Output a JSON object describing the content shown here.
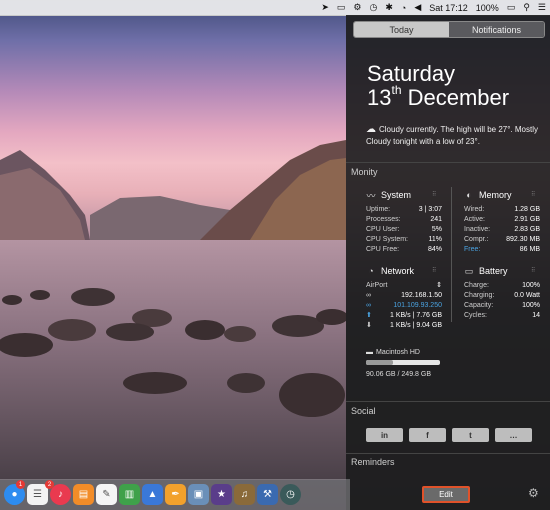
{
  "menubar": {
    "time": "Sat 17:12",
    "battery": "100%",
    "icons": [
      "location-icon",
      "airplay-icon",
      "gear-icon",
      "time-machine-icon",
      "bluetooth-icon",
      "wifi-icon",
      "volume-icon",
      "battery-icon",
      "search-icon",
      "menu-icon"
    ]
  },
  "notification_center": {
    "tabs": [
      "Today",
      "Notifications"
    ],
    "active_tab": "Notifications",
    "day": "Saturday",
    "date_num": "13",
    "date_suffix": "th",
    "month": "December",
    "weather": "Cloudy currently. The high will be 27°. Mostly Cloudy tonight with a low of 23°.",
    "monity_title": "Monity",
    "system": {
      "title": "System",
      "rows": [
        {
          "label": "Uptime:",
          "value": "3 | 3:07"
        },
        {
          "label": "Processes:",
          "value": "241"
        },
        {
          "label": "CPU User:",
          "value": "5%"
        },
        {
          "label": "CPU System:",
          "value": "11%"
        },
        {
          "label": "CPU Free:",
          "value": "84%"
        }
      ]
    },
    "memory": {
      "title": "Memory",
      "rows": [
        {
          "label": "Wired:",
          "value": "1.28 GB"
        },
        {
          "label": "Active:",
          "value": "2.91 GB"
        },
        {
          "label": "Inactive:",
          "value": "2.83 GB"
        },
        {
          "label": "Compr.:",
          "value": "892.30 MB"
        },
        {
          "label": "Free:",
          "value": "86 MB"
        }
      ]
    },
    "network": {
      "title": "Network",
      "interface": "AirPort",
      "local_ip": "192.168.1.50",
      "public_ip": "101.109.93.250",
      "upload": "1 KB/s | 7.76 GB",
      "download": "1 KB/s | 9.04 GB"
    },
    "battery": {
      "title": "Battery",
      "rows": [
        {
          "label": "Charge:",
          "value": "100%"
        },
        {
          "label": "Charging:",
          "value": "0.0 Watt"
        },
        {
          "label": "Capacity:",
          "value": "100%"
        },
        {
          "label": "Cycles:",
          "value": "14"
        }
      ]
    },
    "disk": {
      "name": "Macintosh HD",
      "usage": "90.06 GB / 249.8 GB",
      "used_fraction": 0.36
    },
    "social_title": "Social",
    "social_buttons": [
      "in",
      "f",
      "t",
      "…"
    ],
    "reminders_title": "Reminders",
    "edit_label": "Edit"
  },
  "dock": {
    "apps": [
      "Messages",
      "Reminders",
      "Music",
      "Books",
      "TextEdit",
      "Numbers",
      "Keynote",
      "Pages",
      "iPhoto",
      "iMovie",
      "GarageBand",
      "Xcode",
      "Time Machine"
    ],
    "badges": {
      "Messages": "1",
      "Reminders": "2"
    }
  }
}
